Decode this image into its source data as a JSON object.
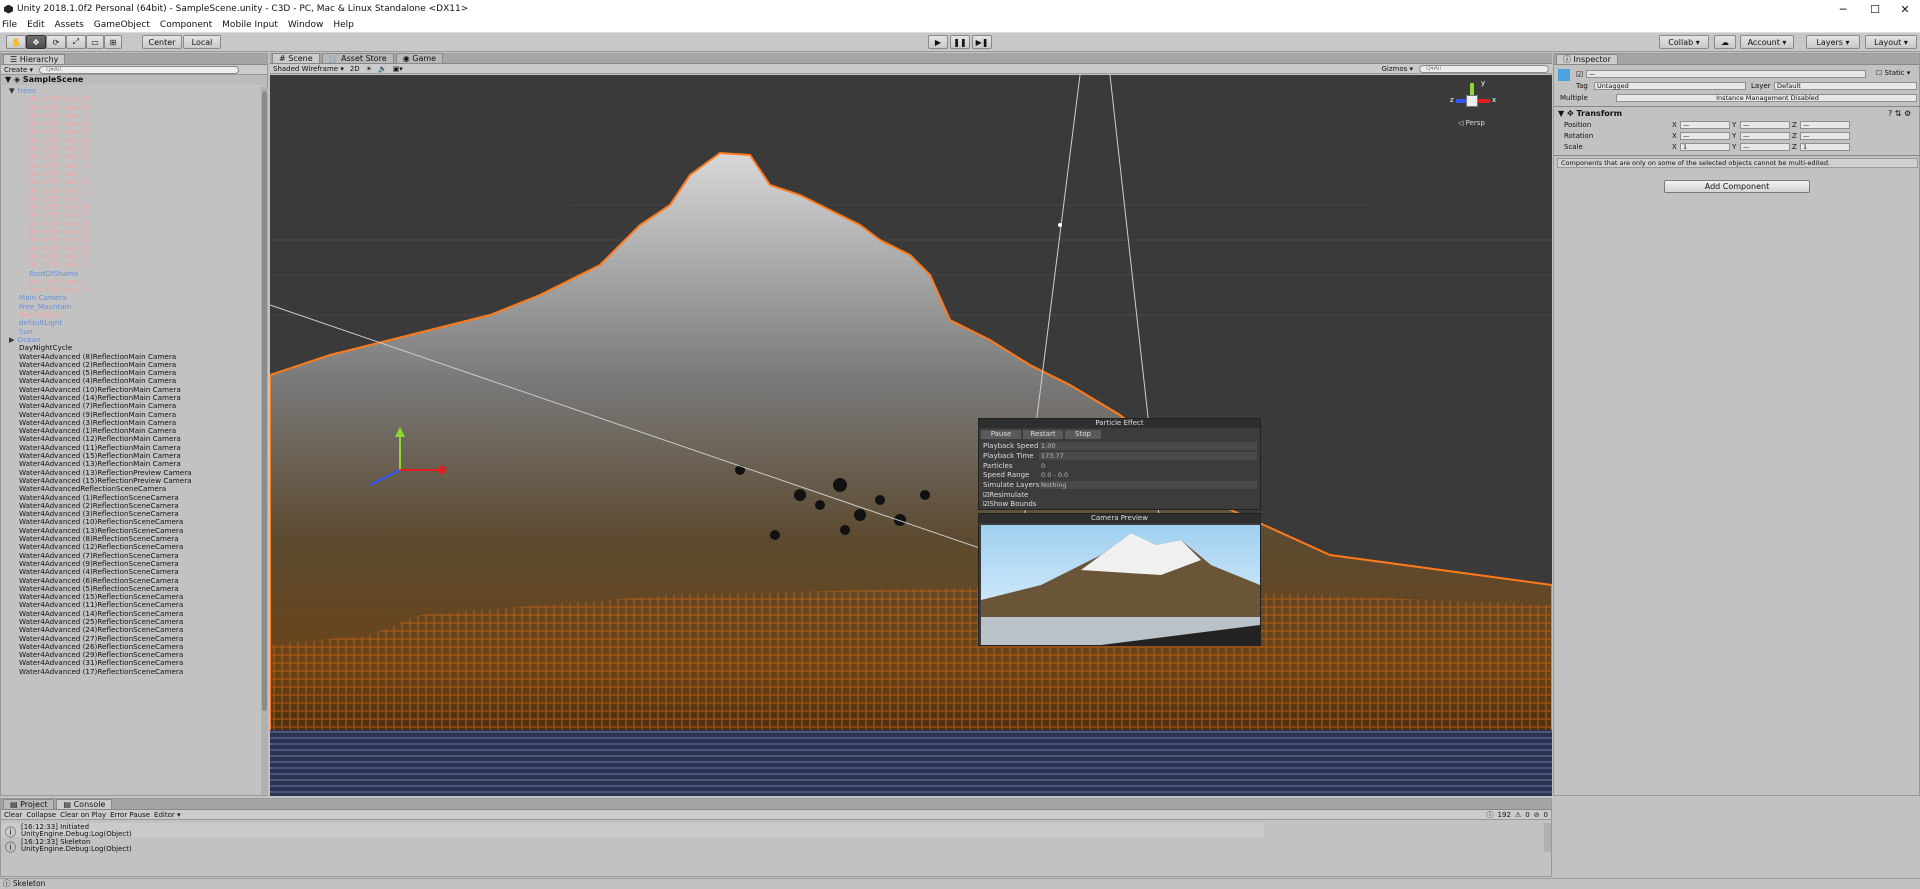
{
  "window": {
    "title": "Unity 2018.1.0f2 Personal (64bit) - SampleScene.unity - C3D - PC, Mac & Linux Standalone <DX11>",
    "min": "─",
    "max": "☐",
    "close": "✕"
  },
  "menu": [
    "File",
    "Edit",
    "Assets",
    "GameObject",
    "Component",
    "Mobile Input",
    "Window",
    "Help"
  ],
  "toolbar": {
    "center": "Center",
    "local": "Local",
    "play": "▶",
    "pause": "❚❚",
    "step": "▶❚",
    "collab": "Collab ▾",
    "account": "Account",
    "layers": "Layers",
    "layout": "Layout"
  },
  "hierarchy": {
    "tab": "Hierarchy",
    "create": "Create ▾",
    "search": "Q▾All",
    "scene": "SampleScene",
    "items": [
      {
        "t": "trees",
        "c": "blue",
        "i": 1,
        "arrow": "▼"
      },
      {
        "t": "RootOfShame (9)",
        "c": "pink",
        "i": 2
      },
      {
        "t": "RootOfShame (8)",
        "c": "pink",
        "i": 2
      },
      {
        "t": "RootOfShame (7)",
        "c": "pink",
        "i": 2
      },
      {
        "t": "RootOfShame (6)",
        "c": "pink",
        "i": 2
      },
      {
        "t": "RootOfShame (5)",
        "c": "pink",
        "i": 2
      },
      {
        "t": "RootOfShame (4)",
        "c": "pink",
        "i": 2
      },
      {
        "t": "RootOfShame (3)",
        "c": "pink",
        "i": 2
      },
      {
        "t": "RootOfShame (2)",
        "c": "pink",
        "i": 2
      },
      {
        "t": "RootOfShame (1)",
        "c": "pink",
        "i": 2
      },
      {
        "t": "RootOfShame",
        "c": "pink",
        "i": 2
      },
      {
        "t": "RootOfShame (2)",
        "c": "pink",
        "i": 2
      },
      {
        "t": "RootOfShame (1)",
        "c": "pink",
        "i": 2
      },
      {
        "t": "RootOfShame",
        "c": "pink",
        "i": 2
      },
      {
        "t": "RootOfShame (8)",
        "c": "pink",
        "i": 2
      },
      {
        "t": "RootOfShame (7)",
        "c": "pink",
        "i": 2
      },
      {
        "t": "RootOfShame (6)",
        "c": "pink",
        "i": 2
      },
      {
        "t": "RootOfShame (5)",
        "c": "pink",
        "i": 2
      },
      {
        "t": "RootOfShame (4)",
        "c": "pink",
        "i": 2
      },
      {
        "t": "RootOfShame (3)",
        "c": "pink",
        "i": 2
      },
      {
        "t": "RootOfShame (2)",
        "c": "pink",
        "i": 2
      },
      {
        "t": "RootOfShame (1)",
        "c": "pink",
        "i": 2
      },
      {
        "t": "RootOfShame",
        "c": "blue",
        "i": 2
      },
      {
        "t": "Root Of Shame",
        "c": "pink",
        "i": 2
      },
      {
        "t": "RootOfShame (9)",
        "c": "pink",
        "i": 2
      },
      {
        "t": "Main Camera",
        "c": "blue",
        "i": 1
      },
      {
        "t": "Free_Mountain",
        "c": "blue",
        "i": 1
      },
      {
        "t": "ParticleLight",
        "c": "pink",
        "i": 1
      },
      {
        "t": "defaultLight",
        "c": "blue",
        "i": 1
      },
      {
        "t": "Sun",
        "c": "blue",
        "i": 1
      },
      {
        "t": "Ocean",
        "c": "blue",
        "i": 1,
        "arrow": "▶"
      },
      {
        "t": "DayNightCycle",
        "c": "mut",
        "i": 1
      },
      {
        "t": "Water4Advanced (8)ReflectionMain Camera",
        "c": "mut",
        "i": 1
      },
      {
        "t": "Water4Advanced (2)ReflectionMain Camera",
        "c": "mut",
        "i": 1
      },
      {
        "t": "Water4Advanced (5)ReflectionMain Camera",
        "c": "mut",
        "i": 1
      },
      {
        "t": "Water4Advanced (4)ReflectionMain Camera",
        "c": "mut",
        "i": 1
      },
      {
        "t": "Water4Advanced (10)ReflectionMain Camera",
        "c": "mut",
        "i": 1
      },
      {
        "t": "Water4Advanced (14)ReflectionMain Camera",
        "c": "mut",
        "i": 1
      },
      {
        "t": "Water4Advanced (7)ReflectionMain Camera",
        "c": "mut",
        "i": 1
      },
      {
        "t": "Water4Advanced (9)ReflectionMain Camera",
        "c": "mut",
        "i": 1
      },
      {
        "t": "Water4Advanced (3)ReflectionMain Camera",
        "c": "mut",
        "i": 1
      },
      {
        "t": "Water4Advanced (1)ReflectionMain Camera",
        "c": "mut",
        "i": 1
      },
      {
        "t": "Water4Advanced (12)ReflectionMain Camera",
        "c": "mut",
        "i": 1
      },
      {
        "t": "Water4Advanced (11)ReflectionMain Camera",
        "c": "mut",
        "i": 1
      },
      {
        "t": "Water4Advanced (15)ReflectionMain Camera",
        "c": "mut",
        "i": 1
      },
      {
        "t": "Water4Advanced (13)ReflectionMain Camera",
        "c": "mut",
        "i": 1
      },
      {
        "t": "Water4Advanced (13)ReflectionPreview Camera",
        "c": "mut",
        "i": 1
      },
      {
        "t": "Water4Advanced (15)ReflectionPreview Camera",
        "c": "mut",
        "i": 1
      },
      {
        "t": "Water4AdvancedReflectionSceneCamera",
        "c": "mut",
        "i": 1
      },
      {
        "t": "Water4Advanced (1)ReflectionSceneCamera",
        "c": "mut",
        "i": 1
      },
      {
        "t": "Water4Advanced (2)ReflectionSceneCamera",
        "c": "mut",
        "i": 1
      },
      {
        "t": "Water4Advanced (3)ReflectionSceneCamera",
        "c": "mut",
        "i": 1
      },
      {
        "t": "Water4Advanced (10)ReflectionSceneCamera",
        "c": "mut",
        "i": 1
      },
      {
        "t": "Water4Advanced (13)ReflectionSceneCamera",
        "c": "mut",
        "i": 1
      },
      {
        "t": "Water4Advanced (8)ReflectionSceneCamera",
        "c": "mut",
        "i": 1
      },
      {
        "t": "Water4Advanced (12)ReflectionSceneCamera",
        "c": "mut",
        "i": 1
      },
      {
        "t": "Water4Advanced (7)ReflectionSceneCamera",
        "c": "mut",
        "i": 1
      },
      {
        "t": "Water4Advanced (9)ReflectionSceneCamera",
        "c": "mut",
        "i": 1
      },
      {
        "t": "Water4Advanced (4)ReflectionSceneCamera",
        "c": "mut",
        "i": 1
      },
      {
        "t": "Water4Advanced (6)ReflectionSceneCamera",
        "c": "mut",
        "i": 1
      },
      {
        "t": "Water4Advanced (5)ReflectionSceneCamera",
        "c": "mut",
        "i": 1
      },
      {
        "t": "Water4Advanced (15)ReflectionSceneCamera",
        "c": "mut",
        "i": 1
      },
      {
        "t": "Water4Advanced (11)ReflectionSceneCamera",
        "c": "mut",
        "i": 1
      },
      {
        "t": "Water4Advanced (14)ReflectionSceneCamera",
        "c": "mut",
        "i": 1
      },
      {
        "t": "Water4Advanced (25)ReflectionSceneCamera",
        "c": "mut",
        "i": 1
      },
      {
        "t": "Water4Advanced (24)ReflectionSceneCamera",
        "c": "mut",
        "i": 1
      },
      {
        "t": "Water4Advanced (27)ReflectionSceneCamera",
        "c": "mut",
        "i": 1
      },
      {
        "t": "Water4Advanced (26)ReflectionSceneCamera",
        "c": "mut",
        "i": 1
      },
      {
        "t": "Water4Advanced (29)ReflectionSceneCamera",
        "c": "mut",
        "i": 1
      },
      {
        "t": "Water4Advanced (31)ReflectionSceneCamera",
        "c": "mut",
        "i": 1
      },
      {
        "t": "Water4Advanced (17)ReflectionSceneCamera",
        "c": "mut",
        "i": 1
      }
    ]
  },
  "scene": {
    "tabs": [
      "Scene",
      "Asset Store",
      "Game"
    ],
    "shading": "Shaded Wireframe",
    "mode2d": "2D",
    "gizmos": "Gizmos ▾",
    "search": "Q▾All",
    "persp": "◁ Persp",
    "axes": {
      "x": "x",
      "y": "y",
      "z": "z"
    }
  },
  "particle": {
    "title": "Particle Effect",
    "pause": "Pause",
    "restart": "Restart",
    "stop": "Stop",
    "rows": [
      {
        "l": "Playback Speed",
        "v": "1.00"
      },
      {
        "l": "Playback Time",
        "v": "173.77"
      },
      {
        "l": "Particles",
        "v": "0"
      },
      {
        "l": "Speed Range",
        "v": "0.0 - 0.0"
      },
      {
        "l": "Simulate Layers",
        "v": "Nothing"
      }
    ],
    "resimulate": "Resimulate",
    "showbounds": "Show Bounds"
  },
  "preview": {
    "title": "Camera Preview"
  },
  "inspector": {
    "tab": "Inspector",
    "name": "—",
    "static": "Static",
    "tag_label": "Tag",
    "tag": "Untagged",
    "layer_label": "Layer",
    "layer": "Default",
    "multiple": "Multiple",
    "instance": "Instance Management Disabled",
    "transform": "Transform",
    "pos": "Position",
    "rot": "Rotation",
    "scl": "Scale",
    "pos_v": [
      "—",
      "—",
      "—"
    ],
    "rot_v": [
      "—",
      "—",
      "—"
    ],
    "scl_v": [
      "1",
      "—",
      "1"
    ],
    "axes": [
      "X",
      "Y",
      "Z"
    ],
    "note": "Components that are only on some of the selected objects cannot be multi-edited.",
    "add": "Add Component"
  },
  "bottom": {
    "tabs": [
      "Project",
      "Console"
    ],
    "clear": "Clear",
    "collapse": "Collapse",
    "clearplay": "Clear on Play",
    "errpause": "Error Pause",
    "editor": "Editor ▾",
    "counts": [
      "192",
      "0",
      "0"
    ],
    "msgs": [
      {
        "a": "[16:12:33] Initiated",
        "b": "UnityEngine.Debug:Log(Object)"
      },
      {
        "a": "[16:12:33] Skeleton",
        "b": "UnityEngine.Debug:Log(Object)"
      }
    ],
    "status": "Skeleton"
  }
}
